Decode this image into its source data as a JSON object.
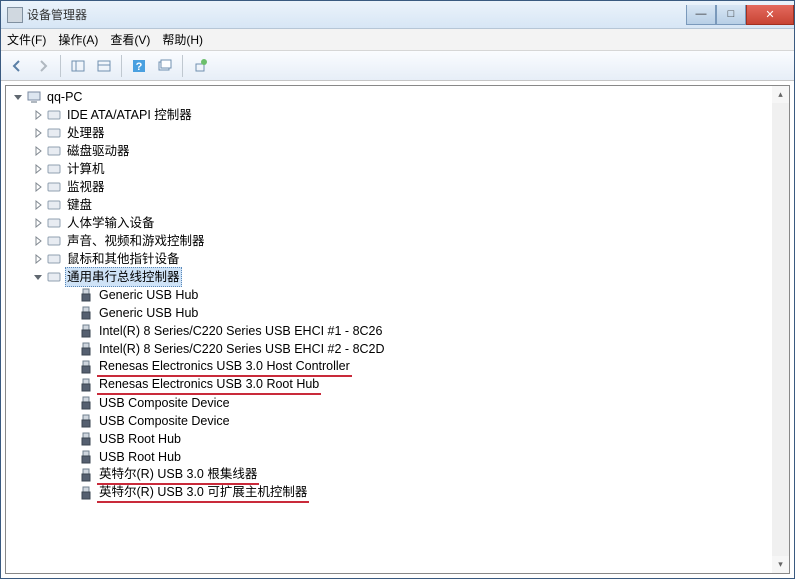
{
  "title": "设备管理器",
  "winbtns": {
    "min": "—",
    "max": "□",
    "close": "✕"
  },
  "menu": {
    "file": "文件(F)",
    "action": "操作(A)",
    "view": "查看(V)",
    "help": "帮助(H)"
  },
  "tree": {
    "root": "qq-PC",
    "cats": [
      "IDE ATA/ATAPI 控制器",
      "处理器",
      "磁盘驱动器",
      "计算机",
      "监视器",
      "键盘",
      "人体学输入设备",
      "声音、视频和游戏控制器",
      "鼠标和其他指针设备",
      "通用串行总线控制器"
    ],
    "usb": [
      "Generic USB Hub",
      "Generic USB Hub",
      "Intel(R) 8 Series/C220 Series USB EHCI #1 - 8C26",
      "Intel(R) 8 Series/C220 Series USB EHCI #2 - 8C2D",
      "Renesas Electronics USB 3.0 Host Controller",
      "Renesas Electronics USB 3.0 Root Hub",
      "USB Composite Device",
      "USB Composite Device",
      "USB Root Hub",
      "USB Root Hub",
      "英特尔(R) USB 3.0 根集线器",
      "英特尔(R) USB 3.0 可扩展主机控制器"
    ]
  },
  "highlighted_usb_indices": [
    4,
    5,
    10,
    11
  ]
}
